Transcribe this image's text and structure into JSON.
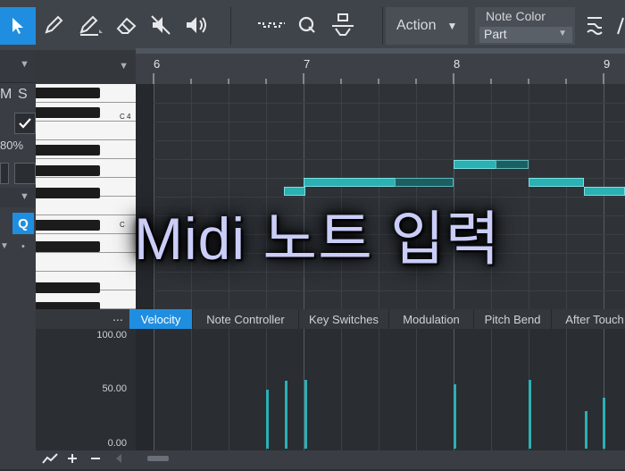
{
  "toolbar": {
    "action_label": "Action",
    "note_color_label": "Note Color",
    "note_color_value": "Part",
    "accent": "#1f8ee0"
  },
  "left_panel": {
    "m_label": "M",
    "s_label": "S",
    "percent": "80%",
    "q_label": "Q",
    "dot": "•"
  },
  "ruler": {
    "bars": [
      "6",
      "7",
      "8",
      "9"
    ]
  },
  "piano": {
    "labels": [
      "C 4",
      "C"
    ]
  },
  "tabs": {
    "more": "...",
    "items": [
      "Velocity",
      "Note Controller",
      "Key Switches",
      "Modulation",
      "Pitch Bend",
      "After Touch"
    ]
  },
  "velocity": {
    "axis": [
      "100.00",
      "50.00",
      "0.00"
    ],
    "values": [
      52,
      60,
      61,
      57,
      61,
      33,
      45
    ]
  },
  "overlay": {
    "text": "Midi 노트 입력"
  },
  "colors": {
    "note": "#2bb0b4",
    "background": "#2b2e33"
  }
}
